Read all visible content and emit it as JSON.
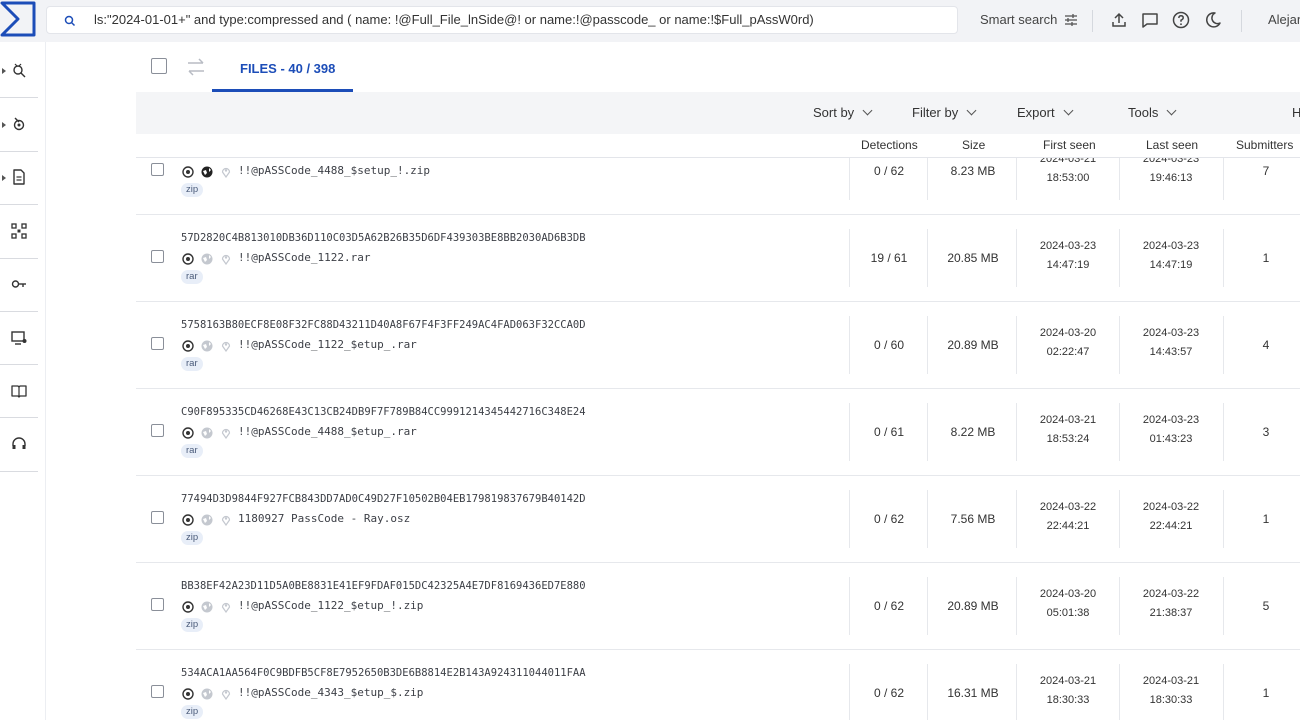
{
  "search": {
    "query": "ls:\"2024-01-01+\" and type:compressed and ( name: !@Full_File_lnSide@! or name:!@passcode_ or name:!$Full_pAssW0rd)"
  },
  "topbar": {
    "smart_search": "Smart search",
    "user": "Alejan"
  },
  "tabs": {
    "files": "FILES - 40 / 398"
  },
  "toolbar": {
    "sort": "Sort by",
    "filter": "Filter by",
    "export": "Export",
    "tools": "Tools",
    "more": "H"
  },
  "columns": {
    "detections": "Detections",
    "size": "Size",
    "first_seen": "First seen",
    "last_seen": "Last seen",
    "submitters": "Submitters"
  },
  "rows": [
    {
      "hash": "",
      "name": "!!@pASSCode_4488_$setup_!.zip",
      "tag": "zip",
      "detections": "0 / 62",
      "size": "8.23 MB",
      "first_date": "2024-03-21",
      "first_time": "18:53:00",
      "last_date": "2024-03-23",
      "last_time": "19:46:13",
      "submitters": "7"
    },
    {
      "hash": "57D2820C4B813010DB36D110C03D5A62B26B35D6DF439303BE8BB2030AD6B3DB",
      "name": "!!@pASSCode_1122.rar",
      "tag": "rar",
      "detections": "19 / 61",
      "size": "20.85 MB",
      "first_date": "2024-03-23",
      "first_time": "14:47:19",
      "last_date": "2024-03-23",
      "last_time": "14:47:19",
      "submitters": "1"
    },
    {
      "hash": "5758163B80ECF8E08F32FC88D43211D40A8F67F4F3FF249AC4FAD063F32CCA0D",
      "name": "!!@pASSCode_1122_$etup_.rar",
      "tag": "rar",
      "detections": "0 / 60",
      "size": "20.89 MB",
      "first_date": "2024-03-20",
      "first_time": "02:22:47",
      "last_date": "2024-03-23",
      "last_time": "14:43:57",
      "submitters": "4"
    },
    {
      "hash": "C90F895335CD46268E43C13CB24DB9F7F789B84CC9991214345442716C348E24",
      "name": "!!@pASSCode_4488_$etup_.rar",
      "tag": "rar",
      "detections": "0 / 61",
      "size": "8.22 MB",
      "first_date": "2024-03-21",
      "first_time": "18:53:24",
      "last_date": "2024-03-23",
      "last_time": "01:43:23",
      "submitters": "3"
    },
    {
      "hash": "77494D3D9844F927FCB843DD7AD0C49D27F10502B04EB179819837679B40142D",
      "name": "1180927 PassCode - Ray.osz",
      "tag": "zip",
      "detections": "0 / 62",
      "size": "7.56 MB",
      "first_date": "2024-03-22",
      "first_time": "22:44:21",
      "last_date": "2024-03-22",
      "last_time": "22:44:21",
      "submitters": "1"
    },
    {
      "hash": "BB38EF42A23D11D5A0BE8831E41EF9FDAF015DC42325A4E7DF8169436ED7E880",
      "name": "!!@pASSCode_1122_$etup_!.zip",
      "tag": "zip",
      "detections": "0 / 62",
      "size": "20.89 MB",
      "first_date": "2024-03-20",
      "first_time": "05:01:38",
      "last_date": "2024-03-22",
      "last_time": "21:38:37",
      "submitters": "5"
    },
    {
      "hash": "534ACA1AA564F0C9BDFB5CF8E7952650B3DE6B8814E2B143A924311044011FAA",
      "name": "!!@pASSCode_4343_$etup_$.zip",
      "tag": "zip",
      "detections": "0 / 62",
      "size": "16.31 MB",
      "first_date": "2024-03-21",
      "first_time": "18:30:33",
      "last_date": "2024-03-21",
      "last_time": "18:30:33",
      "submitters": "1"
    }
  ]
}
